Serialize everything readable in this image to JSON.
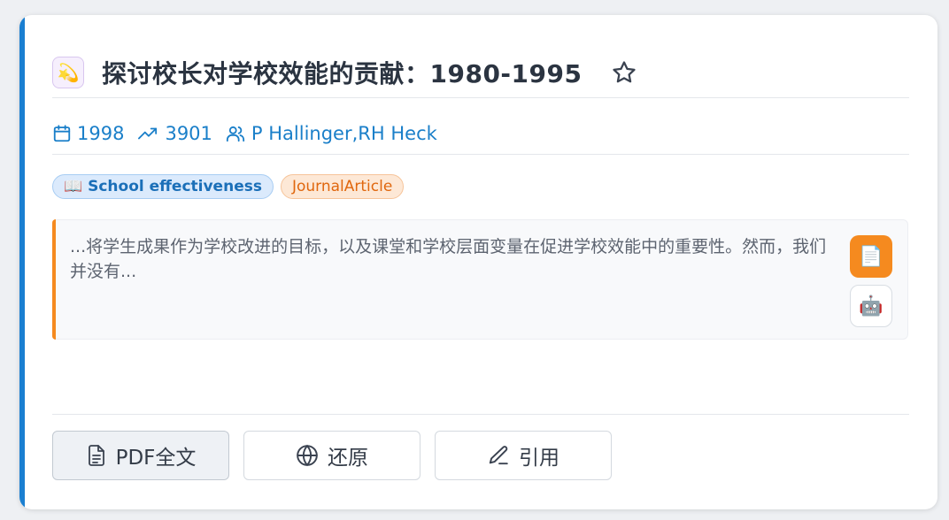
{
  "paper": {
    "title": "探讨校长对学校效能的贡献：1980-1995",
    "title_icon": "💫",
    "year": "1998",
    "citations": "3901",
    "authors": [
      "P Hallinger",
      "RH Heck"
    ],
    "author_separator": ", ",
    "abstract": "...将学生成果作为学校改进的目标，以及课堂和学校层面变量在促进学校效能中的重要性。然而，我们并没有..."
  },
  "tags": {
    "topic": "📖 School effectiveness",
    "type": "JournalArticle"
  },
  "side_actions": {
    "doc_icon": "📄",
    "robot_icon": "🤖"
  },
  "actions": {
    "pdf_label": "PDF全文",
    "restore_label": "还原",
    "cite_label": "引用"
  },
  "colors": {
    "card_accent": "#1a7fd1",
    "link": "#1a7fc9",
    "abstract_accent": "#f58a1f",
    "topic_tag_bg": "#dbeafc",
    "type_tag_bg": "#fde8d6"
  }
}
